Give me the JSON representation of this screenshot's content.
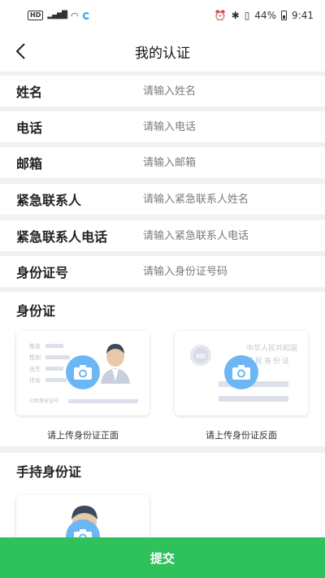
{
  "status_bar": {
    "hd": "HD",
    "network": "4G",
    "battery": "44%",
    "time": "9:41"
  },
  "nav": {
    "title": "我的认证",
    "back_icon": "chevron-left-icon"
  },
  "form": {
    "fields": [
      {
        "label": "姓名",
        "placeholder": "请输入姓名"
      },
      {
        "label": "电话",
        "placeholder": "请输入电话"
      },
      {
        "label": "邮箱",
        "placeholder": "请输入邮箱"
      },
      {
        "label": "紧急联系人",
        "placeholder": "请输入紧急联系人姓名"
      },
      {
        "label": "紧急联系人电话",
        "placeholder": "请输入紧急联系人电话"
      },
      {
        "label": "身份证号",
        "placeholder": "请输入身份证号码"
      }
    ]
  },
  "id_section": {
    "title": "身份证",
    "front": {
      "caption": "请上传身份证正面",
      "sample_labels": [
        "姓名",
        "性别",
        "出生",
        "住址",
        "公民身份证号"
      ]
    },
    "back": {
      "caption": "请上传身份证反面",
      "sample_title_1": "中华人民共和国",
      "sample_title_2": "居民身份证"
    }
  },
  "handheld_section": {
    "title": "手持身份证"
  },
  "submit_label": "提交",
  "colors": {
    "accent": "#2fc15c",
    "camera": "#6cb6f5",
    "background": "#f1f1f1"
  }
}
